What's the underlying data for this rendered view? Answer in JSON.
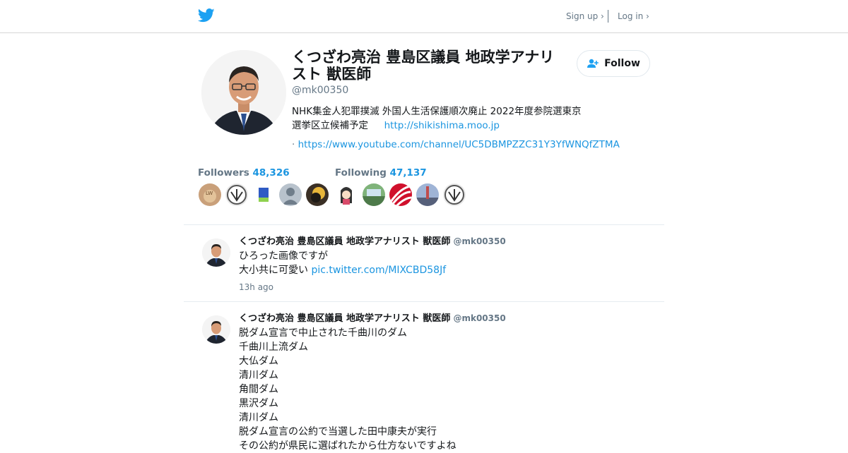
{
  "nav": {
    "signup": "Sign up ›",
    "login": "Log in ›"
  },
  "profile": {
    "name": "くつざわ亮治 豊島区議員 地政学アナリスト 獣医師",
    "handle": "@mk00350",
    "bio_line1": "NHK集金人犯罪撲滅 外国人生活保護順次廃止 2022年度参院選東京",
    "bio_line2": "選挙区立候補予定",
    "bio_link1": "http://shikishima.moo.jp",
    "bio_dot": "·",
    "bio_link2": "https://www.youtube.com/channel/UC5DBMPZZC31Y3YfWNQfZTMA",
    "follow_label": "Follow"
  },
  "stats": {
    "followers_label": "Followers",
    "followers_count": "48,326",
    "following_label": "Following",
    "following_count": "47,137"
  },
  "tweets": [
    {
      "name": "くつざわ亮治 豊島区議員 地政学アナリスト 獣医師",
      "handle": "@mk00350",
      "line1": "ひろった画像ですが",
      "line2": "大小共に可愛い",
      "link": "pic.twitter.com/MIXCBD58Jf",
      "time": "13h ago"
    },
    {
      "name": "くつざわ亮治 豊島区議員 地政学アナリスト 獣医師",
      "handle": "@mk00350",
      "lines": [
        "脱ダム宣言で中止された千曲川のダム",
        "千曲川上流ダム",
        "大仏ダム",
        "清川ダム",
        "角間ダム",
        "黒沢ダム",
        "清川ダム",
        "脱ダム宣言の公約で当選した田中康夫が実行",
        "その公約が県民に選ばれたから仕方ないですよね"
      ]
    }
  ],
  "colors": {
    "accent": "#1b95e0",
    "muted": "#657786",
    "bird": "#1da1f2"
  }
}
